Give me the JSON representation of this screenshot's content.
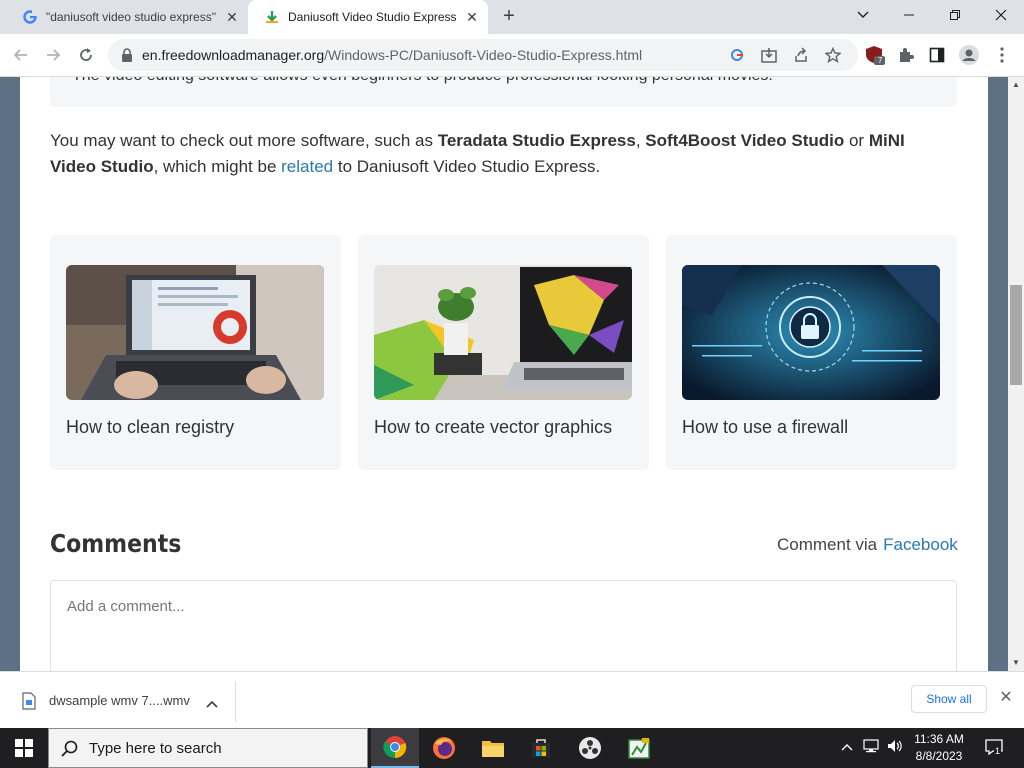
{
  "browser": {
    "tabs": [
      {
        "title": "\"daniusoft video studio express\"",
        "icon": "google-icon",
        "active": false
      },
      {
        "title": "Daniusoft Video Studio Express (f",
        "icon": "fdm-icon",
        "active": true
      }
    ],
    "new_tab_label": "+",
    "url_host": "en.freedownloadmanager.org",
    "url_path": "/Windows-PC/Daniusoft-Video-Studio-Express.html",
    "extension_badge": "7"
  },
  "page": {
    "description_text": "The video editing software allows even beginners to produce professional looking personal movies.",
    "more_para": {
      "prefix": "You may want to check out more software, such as ",
      "link1": "Teradata Studio Express",
      "sep1": ", ",
      "link2": "Soft4Boost Video Studio",
      "sep2": " or ",
      "link3": "MiNI Video Studio",
      "mid": ", which might be ",
      "related": "related",
      "suffix": " to Daniusoft Video Studio Express."
    },
    "cards": [
      {
        "title": "How to clean registry"
      },
      {
        "title": "How to create vector graphics"
      },
      {
        "title": "How to use a firewall"
      }
    ],
    "comments_heading": "Comments",
    "comment_via": "Comment via",
    "facebook": "Facebook",
    "comment_placeholder": "Add a comment..."
  },
  "download_bar": {
    "file_name": "dwsample wmv 7....wmv",
    "show_all": "Show all"
  },
  "taskbar": {
    "search_placeholder": "Type here to search",
    "time": "11:36 AM",
    "date": "8/8/2023",
    "notification_count": "1"
  },
  "colors": {
    "link": "#2a7ab0",
    "page_side_bg": "#5e7184",
    "card_bg": "#f4f6f8"
  }
}
